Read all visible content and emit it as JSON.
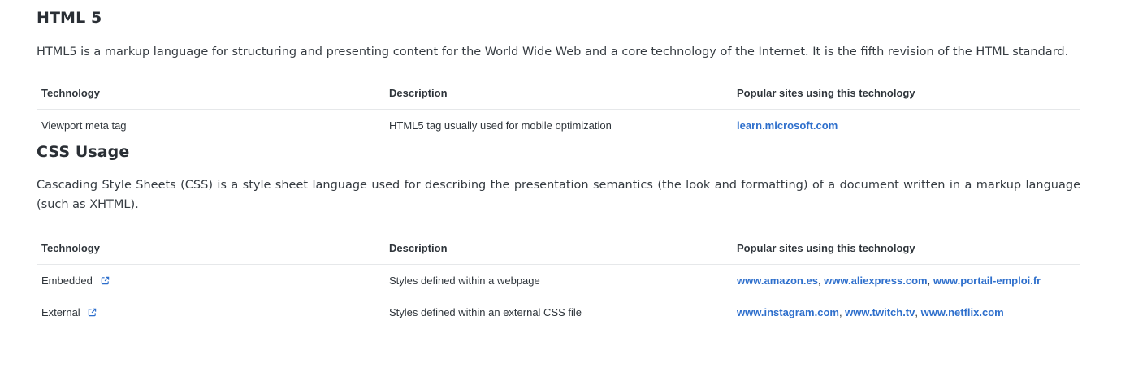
{
  "html5": {
    "title": "HTML 5",
    "description": "HTML5 is a markup language for structuring and presenting content for the World Wide Web and a core technology of the Internet. It is the fifth revision of the HTML standard.",
    "headers": [
      "Technology",
      "Description",
      "Popular sites using this technology"
    ],
    "rows": [
      {
        "technology": "Viewport meta tag",
        "description": "HTML5 tag usually used for mobile optimization",
        "sites": [
          "learn.microsoft.com"
        ]
      }
    ]
  },
  "css": {
    "title": "CSS Usage",
    "description": "Cascading Style Sheets (CSS) is a style sheet language used for describing the presentation semantics (the look and formatting) of a document written in a markup language (such as XHTML).",
    "headers": [
      "Technology",
      "Description",
      "Popular sites using this technology"
    ],
    "rows": [
      {
        "technology": "Embedded",
        "external_link_icon": "external-link-icon",
        "description": "Styles defined within a webpage",
        "sites": [
          "www.amazon.es",
          "www.aliexpress.com",
          "www.portail-emploi.fr"
        ]
      },
      {
        "technology": "External",
        "external_link_icon": "external-link-icon",
        "description": "Styles defined within an external CSS file",
        "sites": [
          "www.instagram.com",
          "www.twitch.tv",
          "www.netflix.com"
        ]
      }
    ]
  },
  "separator": ", ",
  "colors": {
    "link": "#2e6fcc",
    "text": "#333a41",
    "heading": "#2a2f35",
    "row_border": "#eceef0"
  }
}
